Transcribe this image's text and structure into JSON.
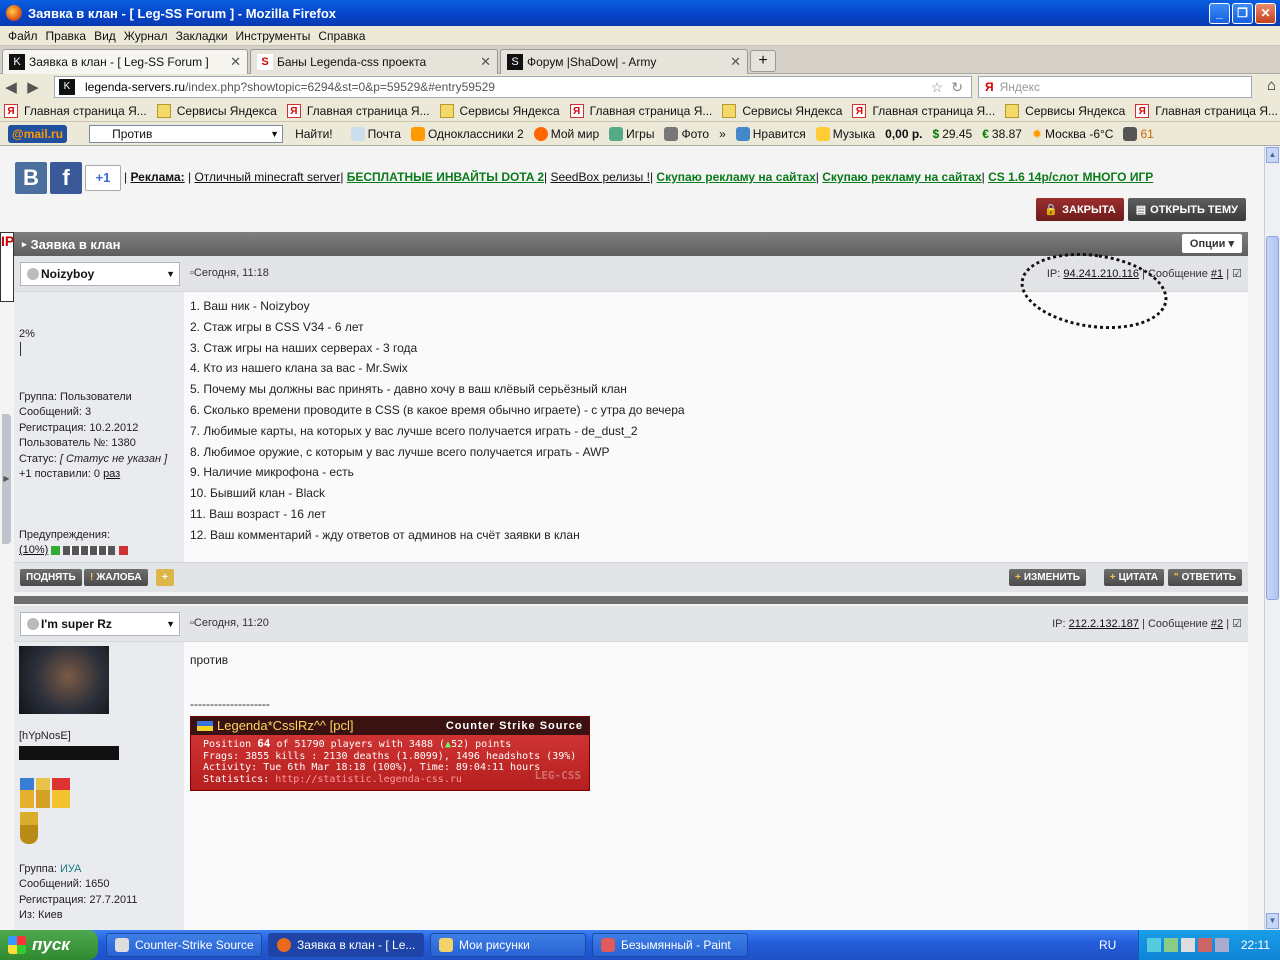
{
  "window": {
    "title": "Заявка в клан - [ Leg-SS Forum ] - Mozilla Firefox"
  },
  "menu": [
    "Файл",
    "Правка",
    "Вид",
    "Журнал",
    "Закладки",
    "Инструменты",
    "Справка"
  ],
  "tabs": [
    {
      "label": "Заявка в клан - [ Leg-SS Forum ]"
    },
    {
      "label": "Баны Legenda-css проекта"
    },
    {
      "label": "Форум |ShaDow| - Army"
    }
  ],
  "nav": {
    "url_host": "legenda-servers.ru",
    "url_path": "/index.php?showtopic=6294&st=0&p=59529&#entry59529",
    "search_placeholder": "Яндекс"
  },
  "bookmarks": [
    "Главная страница Я...",
    "Сервисы Яндекса",
    "Главная страница Я...",
    "Сервисы Яндекса",
    "Главная страница Я...",
    "Сервисы Яндекса",
    "Главная страница Я...",
    "Сервисы Яндекса",
    "Главная страница Я..."
  ],
  "mailbar": {
    "logo_a": "@mail",
    "logo_b": ".ru",
    "search_value": "Против",
    "find": "Найти!",
    "items": [
      "Почта",
      "Одноклассники 2",
      "Мой мир",
      "Игры",
      "Фото",
      "»",
      "Нравится",
      "Музыка",
      "0,00 р.",
      "29.45",
      "38.87",
      "Москва -6°C",
      "61"
    ]
  },
  "ads": {
    "label": "Реклама:",
    "links": [
      "Отличный minecraft server",
      "БЕСПЛАТНЫЕ ИНВАЙТЫ DOTA 2",
      "SeedBox релизы !",
      "Скупаю рекламу на сайтах",
      "Скупаю рекламу на сайтах",
      "CS 1.6 14р/слот МНОГО ИГР"
    ]
  },
  "topbuttons": {
    "closed": "ЗАКРЫТА",
    "open": "ОТКРЫТЬ ТЕМУ"
  },
  "social": {
    "vk": "B",
    "fb": "f",
    "gplus": "+1"
  },
  "lefttag": "IP",
  "topic": {
    "title": "Заявка в клан",
    "options": "Опции"
  },
  "post1": {
    "user": "Noizyboy",
    "date": "Сегодня, 11:18",
    "ip_label": "IP:",
    "ip": "94.241.210.116",
    "msg_label": "| Сообщение",
    "msg_num": "#1",
    "percent": "2%",
    "group": "Группа: Пользователи",
    "messages": "Сообщений: 3",
    "reg": "Регистрация: 10.2.2012",
    "uid": "Пользователь №: 1380",
    "status_label": "Статус:",
    "status": "[ Статус не указан ]",
    "plus": "+1 поставили: 0",
    "plus_link": "раз",
    "warn_label": "Предупреждения:",
    "warn": "(10%)",
    "lines": [
      "1. Ваш ник - Noizyboy",
      "2. Стаж игры в CSS V34 - 6 лет",
      "3. Стаж игры на наших серверах - 3 года",
      "4. Кто из нашего клана за вас - Mr.Swix",
      "5. Почему мы должны вас принять - давно хочу в ваш клёвый серьёзный клан",
      "6. Сколько времени проводите в CSS (в какое время обычно играете) - с утра до вечера",
      "7. Любимые карты, на которых у вас лучше всего получается играть - de_dust_2",
      "8. Любимое оружие, с которым у вас лучше всего получается играть - AWP",
      "9. Наличие микрофона - есть",
      "10. Бывший клан - Black",
      "11. Ваш возраст - 16 лет",
      "12. Ваш комментарий - жду ответов от админов на счёт заявки в клан"
    ],
    "buttons": {
      "up": "ПОДНЯТЬ",
      "report": "ЖАЛОБА",
      "edit": "ИЗМЕНИТЬ",
      "quote": "ЦИТАТА",
      "reply": "ОТВЕТИТЬ"
    }
  },
  "post2": {
    "user": "I'm super Rz",
    "date": "Сегодня, 11:20",
    "ip_label": "IP:",
    "ip": "212.2.132.187",
    "msg_label": "| Сообщение",
    "msg_num": "#2",
    "nick": "[hYpNosE]",
    "group_label": "Группа:",
    "group": "ИУА",
    "messages": "Сообщений: 1650",
    "reg": "Регистрация: 27.7.2011",
    "from": "Из: Киев",
    "body": "против",
    "sig_sep": "--------------------",
    "sig": {
      "name": "Legenda*CsslRz^^ [pcl]",
      "game": "Counter Strike Source",
      "l1_a": "Position ",
      "l1_pos": "64",
      "l1_b": " of 51790 players with 3488 (",
      "l1_c": "52) points",
      "l2": "Frags: 3855 kills : 2130 deaths (1.8099), 1496 headshots (39%)",
      "l3": "Activity: Tue 6th Mar 18:18 (100%), Time: 89:04:11 hours",
      "l4_a": "Statistics: ",
      "l4_link": "http://statistic.legenda-css.ru",
      "watermark": "LEG-CSS"
    }
  },
  "taskbar": {
    "start": "пуск",
    "tasks": [
      "Counter-Strike Source",
      "Заявка в клан - [ Le...",
      "Мои рисунки",
      "Безымянный - Paint"
    ],
    "lang": "RU",
    "clock": "22:11"
  }
}
